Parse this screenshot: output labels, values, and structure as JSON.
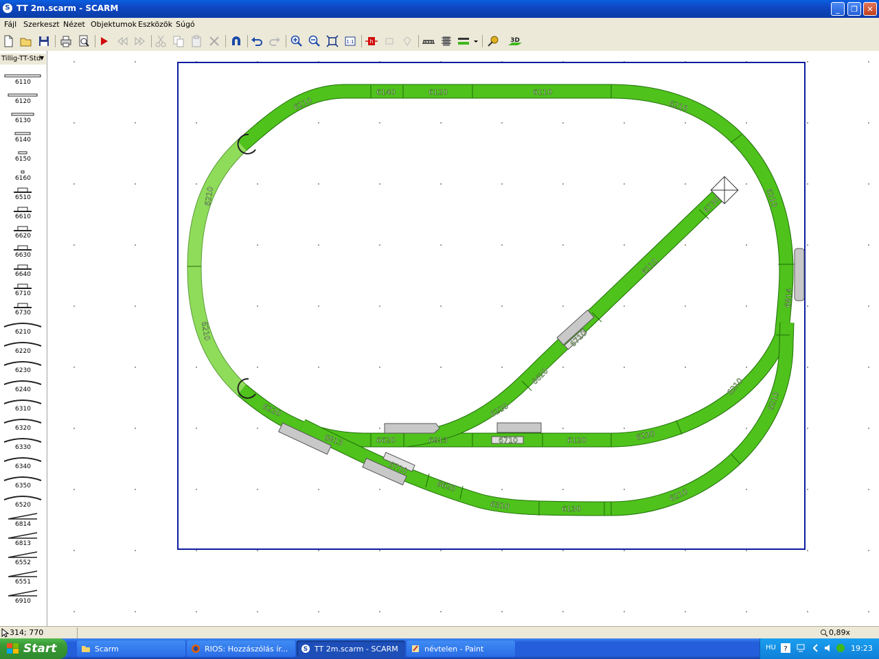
{
  "window": {
    "title": "TT 2m.scarm - SCARM",
    "app_icon_letter": "S"
  },
  "menu": [
    "Fájl",
    "Szerkeszt",
    "Nézet",
    "Objektumok",
    "Eszközök",
    "Súgó"
  ],
  "toolbar": {
    "icons": [
      "new-file-icon",
      "open-folder-icon",
      "save-icon",
      "print-icon",
      "print-preview-icon",
      "select-arrow-icon",
      "rewind-icon",
      "forward-icon",
      "cut-icon",
      "copy-icon",
      "paste-icon",
      "delete-icon",
      "magnet-icon",
      "undo-icon",
      "redo-icon",
      "zoom-in-icon",
      "zoom-out-icon",
      "fit-all-icon",
      "zoom-1to1-icon",
      "height-icon",
      "layer-icon",
      "layer2-icon",
      "bridge-icon",
      "tunnel-icon",
      "track-style-icon",
      "measure-icon",
      "3d-view-icon"
    ],
    "three_d_label": "3D"
  },
  "palette": {
    "library": "Tillig-TT-Std",
    "items": [
      "6110",
      "6120",
      "6130",
      "6140",
      "6150",
      "6160",
      "6510",
      "6610",
      "6620",
      "6630",
      "6640",
      "6710",
      "6730",
      "6210",
      "6220",
      "6230",
      "6240",
      "6310",
      "6320",
      "6330",
      "6340",
      "6350",
      "6520",
      "6814",
      "6813",
      "6552",
      "6551",
      "6910"
    ]
  },
  "layout": {
    "track_color": "#4fc21c",
    "track_color_light": "#8fdc5a",
    "border_color": "#0a1aa0",
    "labels": [
      {
        "id": "a",
        "text": "6140"
      },
      {
        "id": "b",
        "text": "6120"
      },
      {
        "id": "c",
        "text": "6110"
      },
      {
        "id": "d",
        "text": "6210"
      },
      {
        "id": "e",
        "text": "6210"
      },
      {
        "id": "f",
        "text": "6210"
      },
      {
        "id": "g",
        "text": "6210"
      },
      {
        "id": "h",
        "text": "6210"
      },
      {
        "id": "i",
        "text": "6730"
      },
      {
        "id": "j",
        "text": "6110"
      },
      {
        "id": "k",
        "text": "6814"
      },
      {
        "id": "l",
        "text": "6710"
      },
      {
        "id": "m",
        "text": "6620"
      },
      {
        "id": "n",
        "text": "6220"
      },
      {
        "id": "o",
        "text": "6220"
      },
      {
        "id": "p",
        "text": "6813"
      },
      {
        "id": "q",
        "text": "6620"
      },
      {
        "id": "r",
        "text": "6813"
      },
      {
        "id": "s",
        "text": "6710"
      },
      {
        "id": "t",
        "text": "6120"
      },
      {
        "id": "u",
        "text": "6220"
      },
      {
        "id": "v",
        "text": "6210"
      },
      {
        "id": "w",
        "text": "6210"
      },
      {
        "id": "x",
        "text": "6710"
      },
      {
        "id": "y",
        "text": "6620"
      },
      {
        "id": "z",
        "text": "6310"
      },
      {
        "id": "aa",
        "text": "6130"
      },
      {
        "id": "ab",
        "text": "6210"
      }
    ]
  },
  "status": {
    "coords": "314; 770",
    "zoom": "0,89x"
  },
  "taskbar": {
    "start": "Start",
    "tasks": [
      {
        "label": "Scarm",
        "icon": "folder-icon"
      },
      {
        "label": "RIOS: Hozzászólás ír...",
        "icon": "firefox-icon"
      },
      {
        "label": "TT 2m.scarm - SCARM",
        "icon": "scarm-icon"
      },
      {
        "label": "névtelen - Paint",
        "icon": "paint-icon"
      }
    ],
    "lang": "HU",
    "clock": "19:23"
  }
}
